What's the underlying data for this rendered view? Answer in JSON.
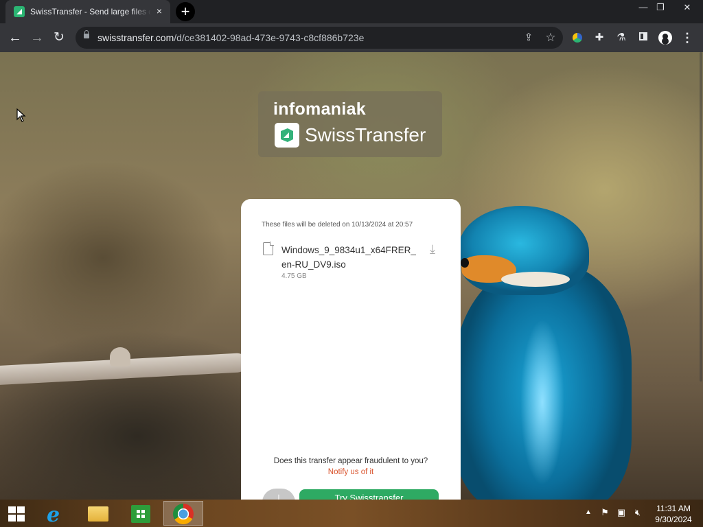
{
  "browser": {
    "tab_title": "SwissTransfer - Send large files quickly",
    "tab_close": "×",
    "new_tab": "+",
    "window_controls": {
      "minimize": "—",
      "maximize": "❐",
      "close": "✕"
    },
    "url_domain": "swisstransfer.com",
    "url_path": "/d/ce381402-98ad-473e-9743-c8cf886b723e",
    "icons": [
      "back-icon",
      "forward-icon",
      "reload-icon",
      "lock-icon",
      "share-icon",
      "star-icon",
      "extension-icon",
      "puzzle-icon",
      "flask-icon",
      "side-panel-icon",
      "profile-icon",
      "menu-icon"
    ]
  },
  "logo": {
    "brand": "infomaniak",
    "product": "SwissTransfer"
  },
  "card": {
    "expire_note": "These files will be deleted on 10/13/2024 at 20:57",
    "file": {
      "name": "Windows_9_9834u1_x64FRER_en-RU_DV9.iso",
      "size": "4.75 GB"
    },
    "fraud_question": "Does this transfer appear fraudulent to you?",
    "fraud_link": "Notify us of it",
    "try_button": "Try Swisstransfer"
  },
  "taskbar": {
    "time": "11:31 AM",
    "date": "9/30/2024",
    "apps": [
      "start",
      "internet-explorer",
      "file-explorer",
      "store",
      "chrome"
    ]
  },
  "colors": {
    "accent_green": "#2eaa63",
    "link_orange": "#d9532c",
    "chrome_dark": "#202124"
  }
}
